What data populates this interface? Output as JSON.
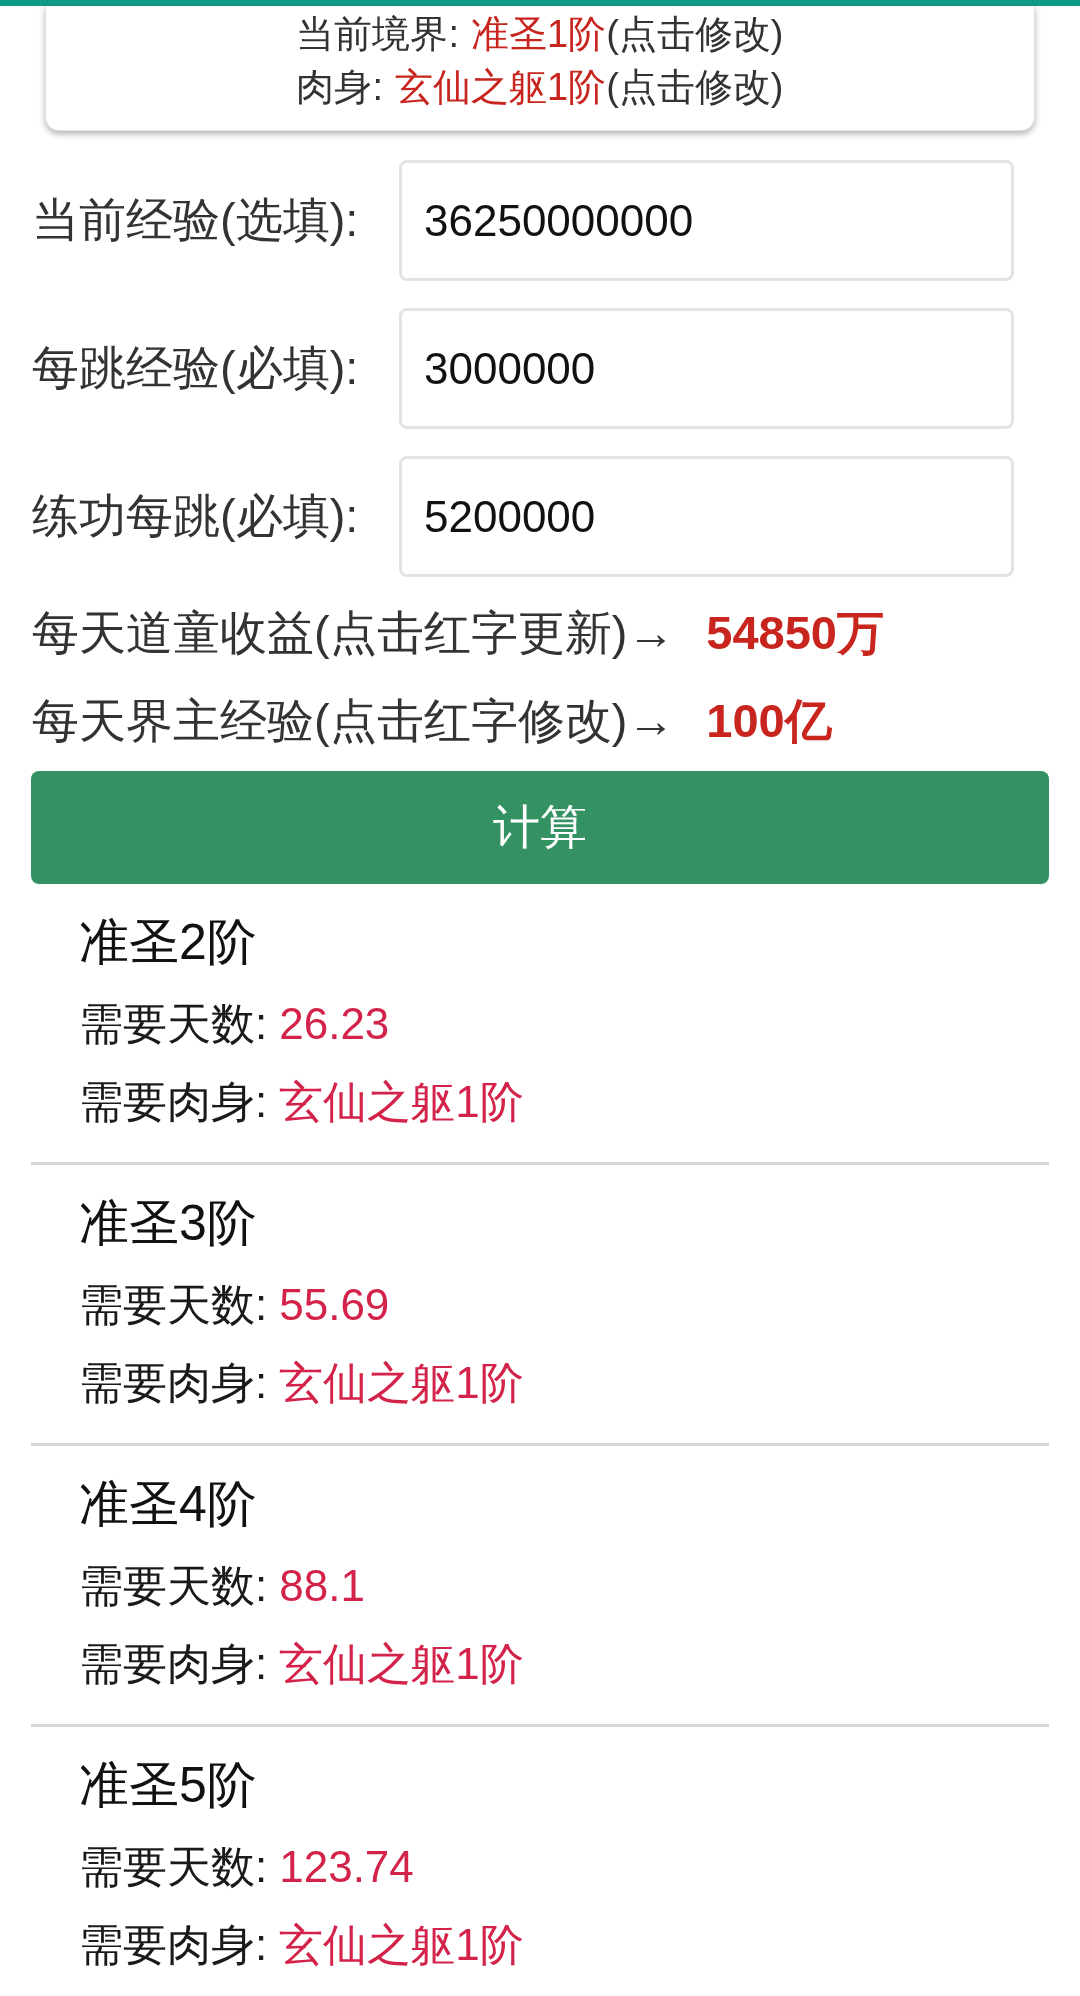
{
  "info_card": {
    "lines": [
      {
        "label": "当前境界:",
        "value": "准圣1阶",
        "hint": "(点击修改)"
      },
      {
        "label": "肉身:",
        "value": "玄仙之躯1阶",
        "hint": "(点击修改)"
      }
    ]
  },
  "fields": [
    {
      "label": "当前经验(选填):",
      "value": "36250000000"
    },
    {
      "label": "每跳经验(必填):",
      "value": "3000000"
    },
    {
      "label": "练功每跳(必填):",
      "value": "5200000"
    }
  ],
  "daily": [
    {
      "label": "每天道童收益(点击红字更新)→",
      "value": "54850万"
    },
    {
      "label": "每天界主经验(点击红字修改)→",
      "value": "100亿"
    }
  ],
  "calculate_button": "计算",
  "results": [
    {
      "title": "准圣2阶",
      "days_label": "需要天数:",
      "days": "26.23",
      "body_label": "需要肉身:",
      "body": "玄仙之躯1阶"
    },
    {
      "title": "准圣3阶",
      "days_label": "需要天数:",
      "days": "55.69",
      "body_label": "需要肉身:",
      "body": "玄仙之躯1阶"
    },
    {
      "title": "准圣4阶",
      "days_label": "需要天数:",
      "days": "88.1",
      "body_label": "需要肉身:",
      "body": "玄仙之躯1阶"
    },
    {
      "title": "准圣5阶",
      "days_label": "需要天数:",
      "days": "123.74",
      "body_label": "需要肉身:",
      "body": "玄仙之躯1阶"
    }
  ]
}
